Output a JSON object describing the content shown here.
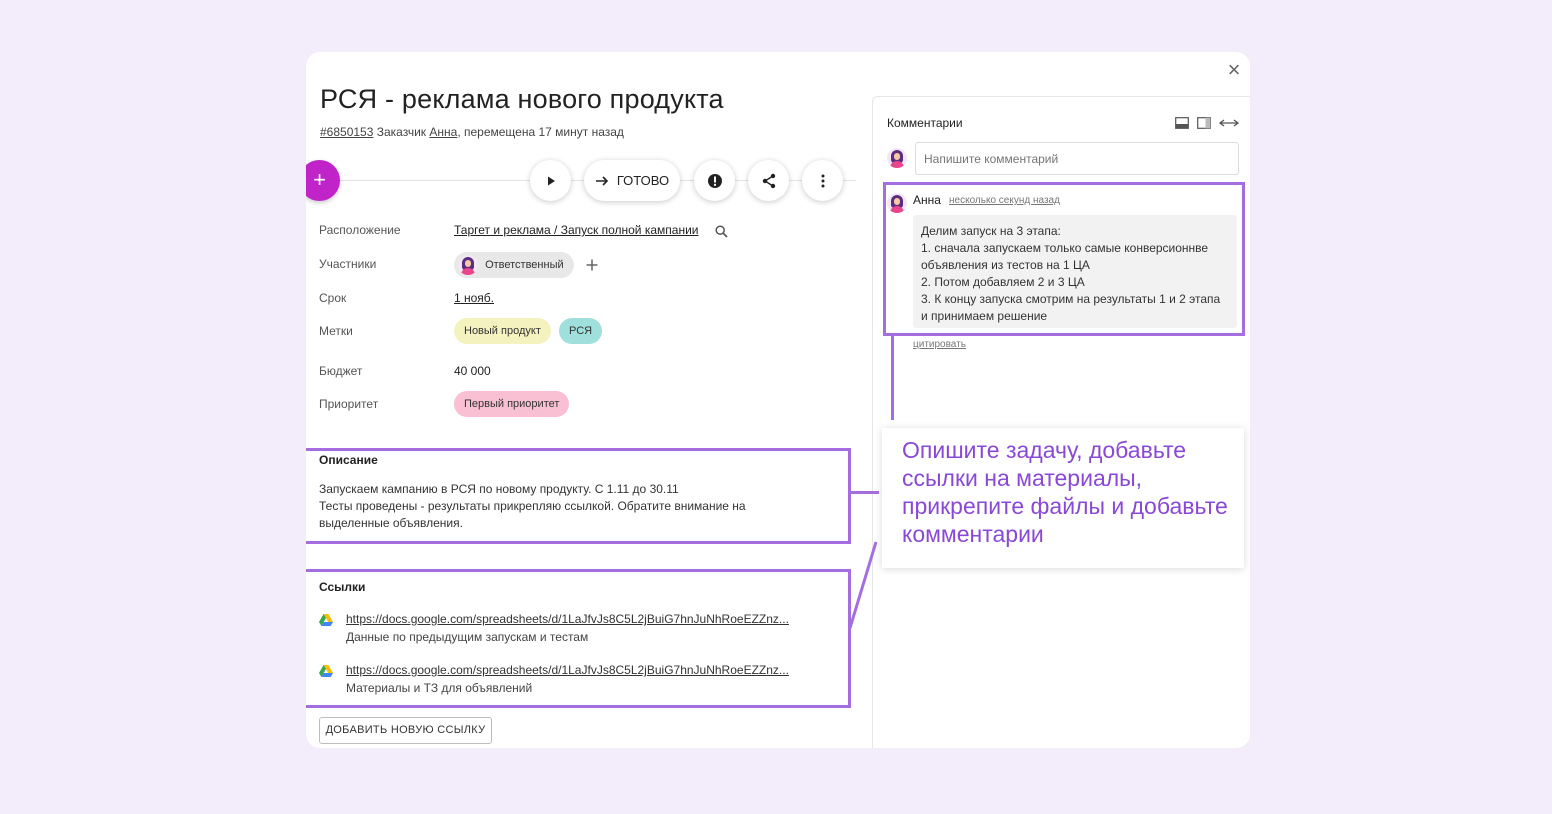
{
  "task": {
    "title": "РСЯ - реклама нового продукта",
    "id": "#6850153",
    "customer_label": "Заказчик",
    "customer": "Анна",
    "moved": ", перемещена 17 минут назад"
  },
  "toolbar": {
    "add_label": "+",
    "done_label": "ГОТОВО"
  },
  "fields": {
    "location": {
      "label": "Расположение",
      "value": "Таргет и реклама / Запуск полной кампании"
    },
    "participants": {
      "label": "Участники",
      "chip": "Ответственный"
    },
    "deadline": {
      "label": "Срок",
      "value": "1 нояб."
    },
    "tags": {
      "label": "Метки",
      "tag1": "Новый продукт",
      "tag2": "РСЯ"
    },
    "budget": {
      "label": "Бюджет",
      "value": "40 000"
    },
    "priority": {
      "label": "Приоритет",
      "value": "Первый приоритет"
    }
  },
  "description": {
    "title": "Описание",
    "line1": "Запускаем кампанию в РСЯ по новому продукту. С 1.11 до 30.11",
    "line2": "Тесты проведены - результаты прикрепляю ссылкой. Обратите внимание на",
    "line3": "выделенные объявления."
  },
  "links": {
    "title": "Ссылки",
    "items": [
      {
        "url": "https://docs.google.com/spreadsheets/d/1LaJfvJs8C5L2jBuiG7hnJuNhRoeEZZnz...",
        "desc": "Данные по предыдущим запускам и тестам"
      },
      {
        "url": "https://docs.google.com/spreadsheets/d/1LaJfvJs8C5L2jBuiG7hnJuNhRoeEZZnz...",
        "desc": "Материалы и ТЗ для объявлений"
      }
    ],
    "add_button": "ДОБАВИТЬ НОВУЮ ССЫЛКУ"
  },
  "comments": {
    "title": "Комментарии",
    "placeholder": "Напишите комментарий",
    "author": "Анна",
    "time": "несколько секунд назад",
    "lines": [
      "Делим запуск на 3 этапа:",
      "1. сначала запускаем только самые конверсионнве",
      "объявления из тестов на 1 ЦА",
      "2. Потом добавляем 2 и 3 ЦА",
      "3. К концу запуска смотрим на результаты 1 и 2 этапа",
      "и принимаем решение"
    ],
    "quote": "цитировать"
  },
  "callout": {
    "text": "Опишите задачу, добавьте ссылки на материалы, прикрепите файлы и добавьте комментарии"
  },
  "colors": {
    "accent": "#a56ee0",
    "fab": "#c024c9",
    "tag_yellow": "#f4f3bf",
    "tag_teal": "#9fe0dc",
    "tag_pink": "#f9c0d3"
  }
}
